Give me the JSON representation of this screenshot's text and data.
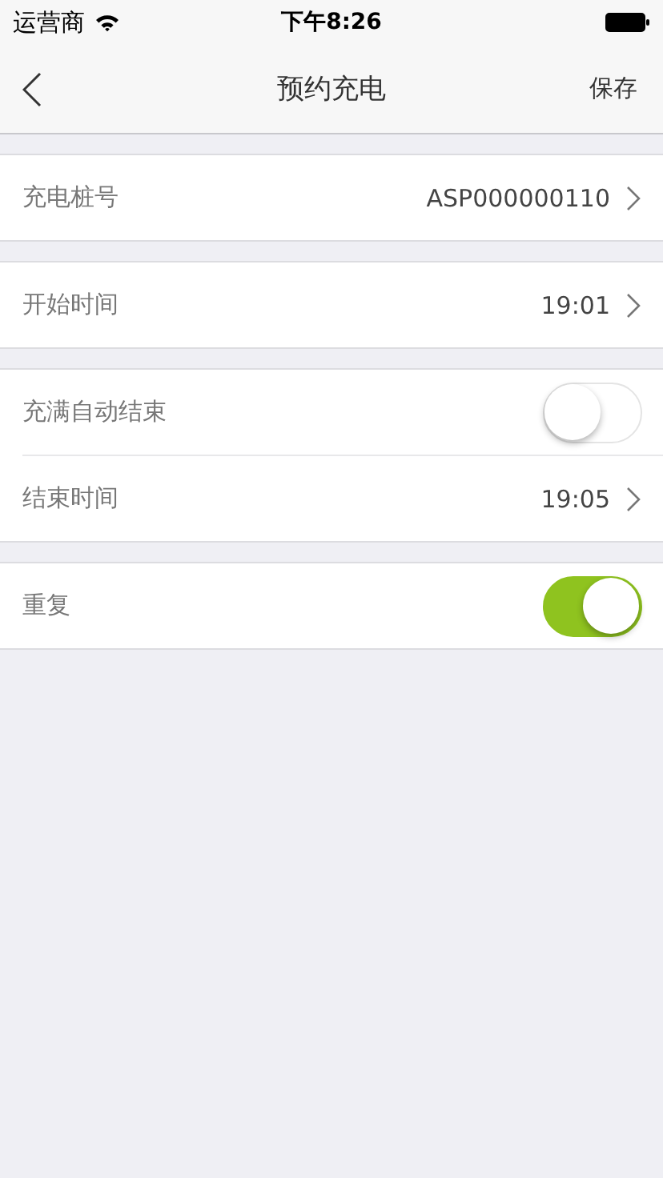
{
  "status_bar": {
    "carrier": "运营商",
    "time": "下午8:26"
  },
  "nav_bar": {
    "title": "预约充电",
    "action": "保存"
  },
  "groups": [
    {
      "rows": [
        {
          "kind": "link",
          "label": "充电桩号",
          "value": "ASP000000110"
        }
      ]
    },
    {
      "rows": [
        {
          "kind": "link",
          "label": "开始时间",
          "value": "19:01"
        }
      ]
    },
    {
      "rows": [
        {
          "kind": "toggle",
          "label": "充满自动结束",
          "on": false
        },
        {
          "kind": "link",
          "label": "结束时间",
          "value": "19:05"
        }
      ]
    },
    {
      "rows": [
        {
          "kind": "toggle",
          "label": "重复",
          "on": true
        }
      ]
    }
  ]
}
